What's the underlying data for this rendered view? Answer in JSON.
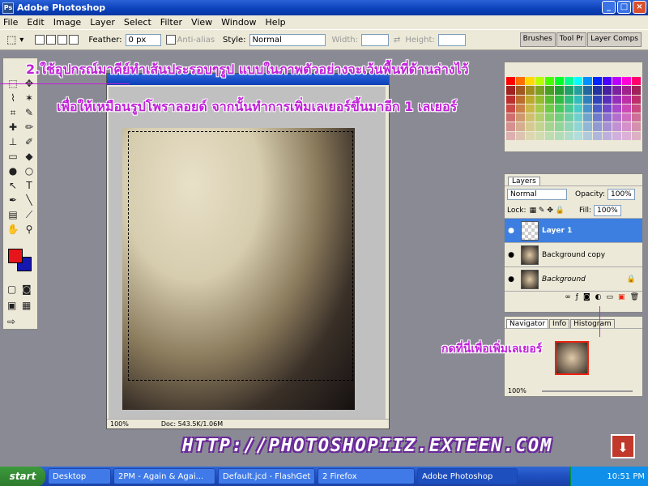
{
  "app": {
    "title": "Adobe Photoshop"
  },
  "menu": [
    "File",
    "Edit",
    "Image",
    "Layer",
    "Select",
    "Filter",
    "View",
    "Window",
    "Help"
  ],
  "options": {
    "feather_label": "Feather:",
    "feather_value": "0 px",
    "antialias_label": "Anti-alias",
    "style_label": "Style:",
    "style_value": "Normal",
    "width_label": "Width:",
    "height_label": "Height:",
    "palette_well": [
      "Brushes",
      "Tool Pr",
      "Layer Comps"
    ]
  },
  "document": {
    "zoom": "100%",
    "doc_size": "Doc: 543.5K/1.06M"
  },
  "layers_panel": {
    "tab": "Layers",
    "blend_mode": "Normal",
    "opacity_label": "Opacity:",
    "opacity_value": "100%",
    "lock_label": "Lock:",
    "fill_label": "Fill:",
    "fill_value": "100%",
    "items": [
      {
        "name": "Layer 1",
        "selected": true
      },
      {
        "name": "Background copy",
        "selected": false
      },
      {
        "name": "Background",
        "selected": false
      }
    ]
  },
  "navigator_panel": {
    "tabs": [
      "Navigator",
      "Info",
      "Histogram"
    ],
    "zoom": "100%"
  },
  "annotations": {
    "line1": "2.ใช้อุปกรณ์มาคีย์ทำเส้นประรอบๆรูป แบบในภาพตัวอย่างจะเว้นพื้นที่ด้านล่างไว้",
    "line2": "เพื่อให้เหมือนรูปโพราลอยด์ จากนั้นทำการเพิ่มเลเยอร์ขึ้นมาอีก 1 เลเยอร์",
    "callout": "กดที่นี่เพื่อเพิ่มเลเยอร์"
  },
  "watermark": "HTTP://PHOTOSHOPIIZ.EXTEEN.COM",
  "taskbar": {
    "start": "start",
    "items": [
      "Desktop",
      "2PM - Again & Agai...",
      "Default.jcd - FlashGet",
      "2 Firefox",
      "Adobe Photoshop"
    ],
    "clock": "10:51 PM"
  },
  "colors": {
    "accent": "#c020d8",
    "foreground": "#e8141c",
    "background": "#1616b0",
    "selected_layer": "#3d7fe0"
  }
}
